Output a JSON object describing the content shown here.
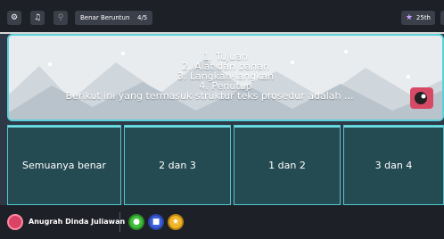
{
  "topbar": {
    "settings_icon": "gear-icon",
    "music_icon": "music-icon",
    "search_icon": "zoom-icon",
    "status_label": "Benar Beruntun",
    "streak_icon": "fire-icon",
    "streak_count": "0",
    "progress": "4/5",
    "rank_icon": "trophy-icon",
    "rank": "25th"
  },
  "question": {
    "lines": [
      "1. Tujuan",
      "2. Alat dan bahan",
      "3. Langkah-langkah",
      "4. Penutup"
    ],
    "prompt": "Berikut ini yang termasuk struktur teks prosedur adalah ..."
  },
  "answers": [
    {
      "label": "Semuanya benar"
    },
    {
      "label": "2 dan 3"
    },
    {
      "label": "1 dan 2"
    },
    {
      "label": "3 dan 4"
    }
  ],
  "player": {
    "name": "Anugrah Dinda Juliawan"
  },
  "powerups": [
    {
      "name": "powerup-green",
      "color": "#3fbf3a"
    },
    {
      "name": "powerup-blue",
      "color": "#3a5fd9"
    },
    {
      "name": "powerup-yellow",
      "color": "#f1b52a"
    }
  ],
  "colors": {
    "accent": "#5bd1d9",
    "answer_bg": "#254b52",
    "bar_bg": "#1e2027"
  }
}
